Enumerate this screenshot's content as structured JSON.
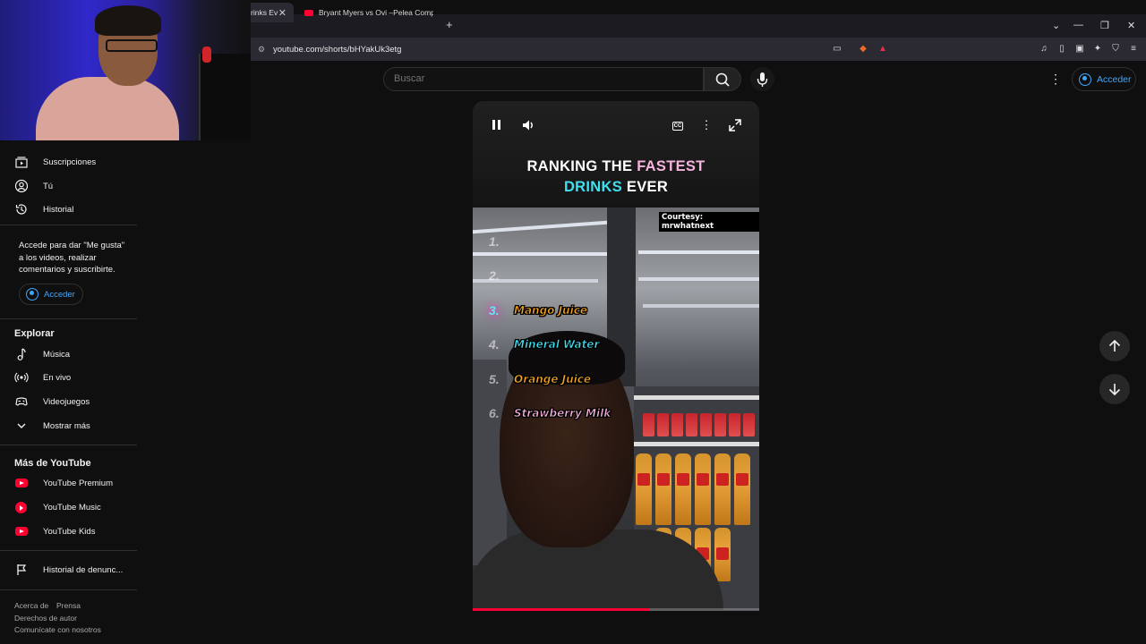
{
  "browser": {
    "tabs": [
      {
        "label": "rinks Ev",
        "active": true
      },
      {
        "label": "Bryant Myers vs Ovi –Pelea Completa",
        "active": false
      }
    ],
    "new_tab": "+",
    "url": "youtube.com/shorts/bHYakUk3etg",
    "window_controls": [
      "⌄",
      "—",
      "❐",
      "✕"
    ]
  },
  "header": {
    "search_placeholder": "Buscar",
    "signin_label": "Acceder"
  },
  "sidebar": {
    "items": [
      {
        "label": "Suscripciones",
        "icon": "subscriptions-icon"
      },
      {
        "label": "Tú",
        "icon": "you-icon"
      },
      {
        "label": "Historial",
        "icon": "history-icon"
      }
    ],
    "signin_prompt": "Accede para dar \"Me gusta\" a los videos, realizar comentarios y suscribirte.",
    "signin_label": "Acceder",
    "explore_title": "Explorar",
    "explore_items": [
      {
        "label": "Música",
        "icon": "music-note-icon"
      },
      {
        "label": "En vivo",
        "icon": "live-icon"
      },
      {
        "label": "Videojuegos",
        "icon": "gaming-icon"
      },
      {
        "label": "Mostrar más",
        "icon": "chevron-down-icon"
      }
    ],
    "more_title": "Más de YouTube",
    "more_items": [
      {
        "label": "YouTube Premium",
        "icon": "youtube-premium-icon"
      },
      {
        "label": "YouTube Music",
        "icon": "youtube-music-icon"
      },
      {
        "label": "YouTube Kids",
        "icon": "youtube-kids-icon"
      }
    ],
    "report_history": "Historial de denunc...",
    "footer_links": [
      "Acerca de",
      "Prensa",
      "Derechos de autor",
      "Comunícate con nosotros"
    ]
  },
  "short": {
    "title_part1": "RANKING THE ",
    "title_highlight1": "FASTEST",
    "title_highlight2": "DRINKS",
    "title_part2": " EVER",
    "courtesy": "Courtesy: mrwhatnext",
    "rankings": [
      {
        "num": "1.",
        "label": ""
      },
      {
        "num": "2.",
        "label": ""
      },
      {
        "num": "3.",
        "label": "Mango Juice",
        "color": "#f5a623"
      },
      {
        "num": "4.",
        "label": "Mineral Water",
        "color": "#3fe0f0"
      },
      {
        "num": "5.",
        "label": "Orange Juice",
        "color": "#f5a623"
      },
      {
        "num": "6.",
        "label": "Strawberry Milk",
        "color": "#f6b4dd"
      }
    ],
    "progress": 0.62
  },
  "colors": {
    "accent_red": "#ff0033",
    "link_blue": "#3ea6ff",
    "background": "#0f0f0f"
  }
}
